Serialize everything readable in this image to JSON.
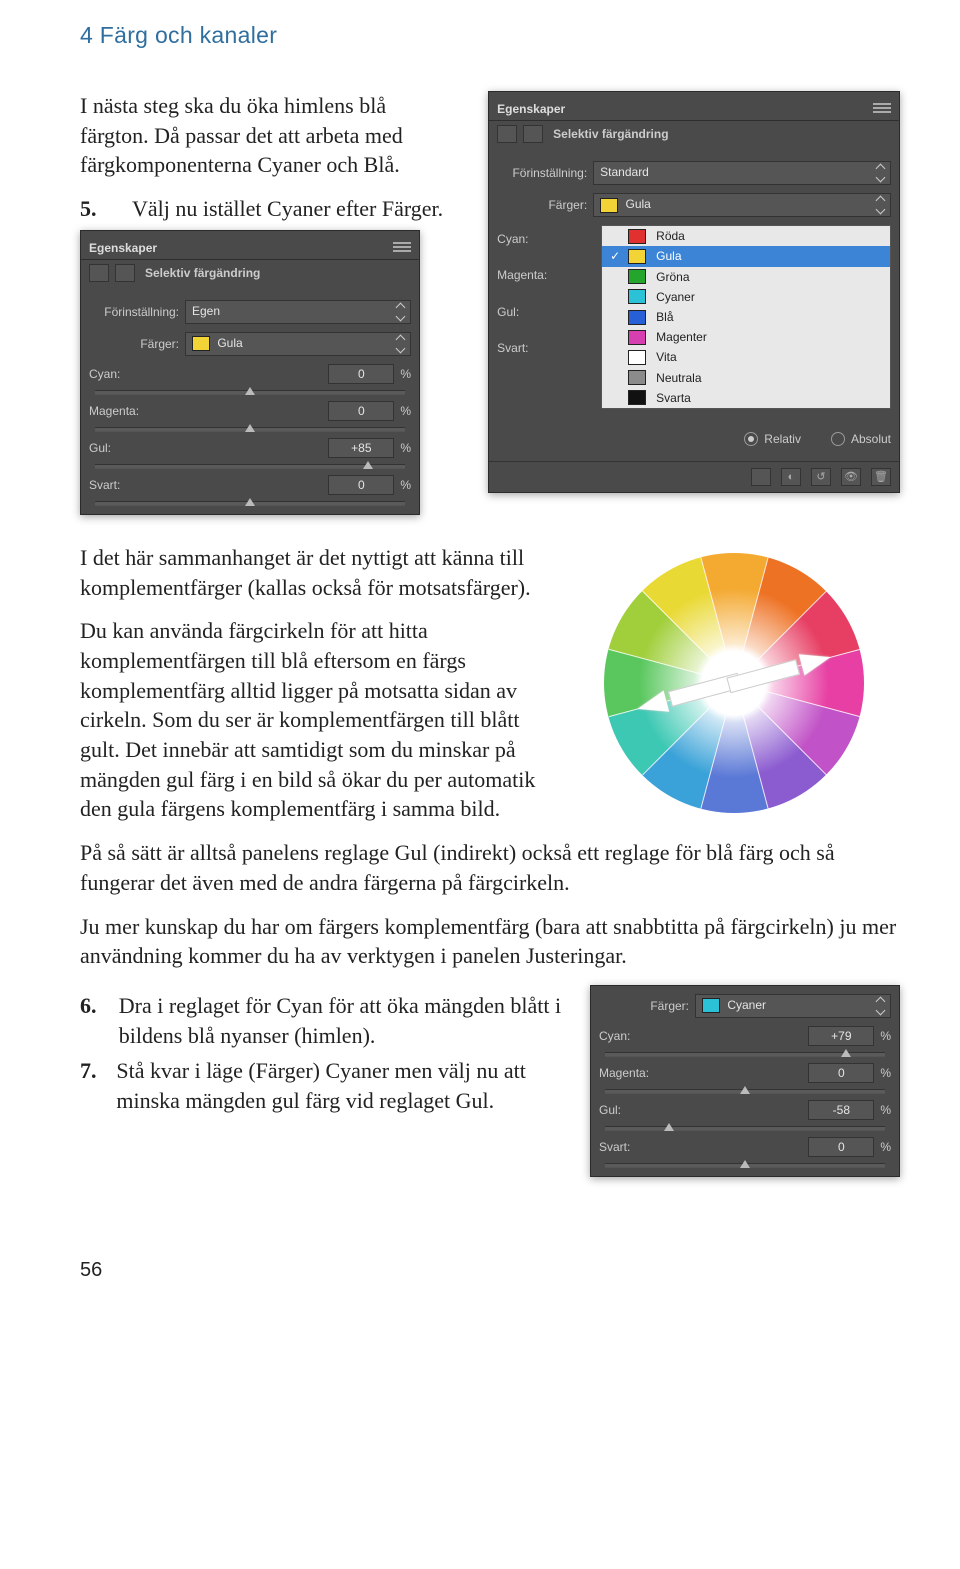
{
  "header": {
    "chapter": "4 Färg och kanaler"
  },
  "intro": [
    "I nästa steg ska du öka himlens blå färgton. Då passar det att arbeta med färgkomponenterna Cyaner och Blå."
  ],
  "step5": {
    "num": "5.",
    "text": "Välj nu istället Cyaner efter Färger."
  },
  "panelA": {
    "title": "Egenskaper",
    "mode": "Selektiv färgändring",
    "preset_lbl": "Förinställning:",
    "preset": "Egen",
    "colors_lbl": "Färger:",
    "colors": "Gula",
    "swatch": "#f2d436",
    "sliders": [
      {
        "name": "Cyan:",
        "val": "0",
        "pos": 50
      },
      {
        "name": "Magenta:",
        "val": "0",
        "pos": 50
      },
      {
        "name": "Gul:",
        "val": "+85",
        "pos": 88
      },
      {
        "name": "Svart:",
        "val": "0",
        "pos": 50
      }
    ],
    "pct": "%"
  },
  "panelB": {
    "title": "Egenskaper",
    "mode": "Selektiv färgändring",
    "preset_lbl": "Förinställning:",
    "preset": "Standard",
    "colors_lbl": "Färger:",
    "colors": "Gula",
    "swatch": "#f2d436",
    "slider_lbls": [
      "Cyan:",
      "Magenta:",
      "Gul:",
      "Svart:"
    ],
    "dropdown": [
      {
        "swatch": "#e03030",
        "label": "Röda"
      },
      {
        "swatch": "#f2d436",
        "label": "Gula",
        "checked": true,
        "selected": true
      },
      {
        "swatch": "#24a52b",
        "label": "Gröna"
      },
      {
        "swatch": "#2bc2d8",
        "label": "Cyaner"
      },
      {
        "swatch": "#2760d6",
        "label": "Blå"
      },
      {
        "swatch": "#d53fb0",
        "label": "Magenter"
      },
      {
        "swatch": "#ffffff",
        "label": "Vita"
      },
      {
        "swatch": "#8b8b8b",
        "label": "Neutrala"
      },
      {
        "swatch": "#111111",
        "label": "Svarta"
      }
    ],
    "radio": {
      "rel": "Relativ",
      "abs": "Absolut"
    }
  },
  "mid": [
    "I det här sammanhanget är det nyttigt att känna till komplementfärger (kallas också för motsatsfärger).",
    "Du kan använda färgcirkeln för att hitta komplementfärgen till blå eftersom en färgs komplementfärg alltid ligger på motsatta sidan av cirkeln. Som du ser är komplementfärgen till blått gult. Det innebär att samtidigt som du minskar på mängden gul färg i en bild så ökar du per automatik den gula färgens komplementfärg i samma bild.",
    "På så sätt är alltså panelens reglage Gul (indirekt) också ett reglage för blå färg och så fungerar det även med de andra färgerna på färgcirkeln.",
    "Ju mer kunskap du har om färgers komplementfärg (bara att snabbtitta på färgcirkeln) ju mer användning kommer du ha av verktygen i panelen Justeringar."
  ],
  "step6": {
    "num": "6.",
    "text": "Dra i reglaget för Cyan för att öka mängden blått i bildens blå nyanser (himlen)."
  },
  "step7": {
    "num": "7.",
    "text": "Stå kvar i läge (Färger) Cyaner men välj nu att minska mängden gul färg vid reglaget Gul."
  },
  "panelC": {
    "colors_lbl": "Färger:",
    "colors": "Cyaner",
    "swatch": "#2bc2d8",
    "pct": "%",
    "sliders": [
      {
        "name": "Cyan:",
        "val": "+79",
        "pos": 86
      },
      {
        "name": "Magenta:",
        "val": "0",
        "pos": 50
      },
      {
        "name": "Gul:",
        "val": "-58",
        "pos": 23
      },
      {
        "name": "Svart:",
        "val": "0",
        "pos": 50
      }
    ]
  },
  "page": "56"
}
